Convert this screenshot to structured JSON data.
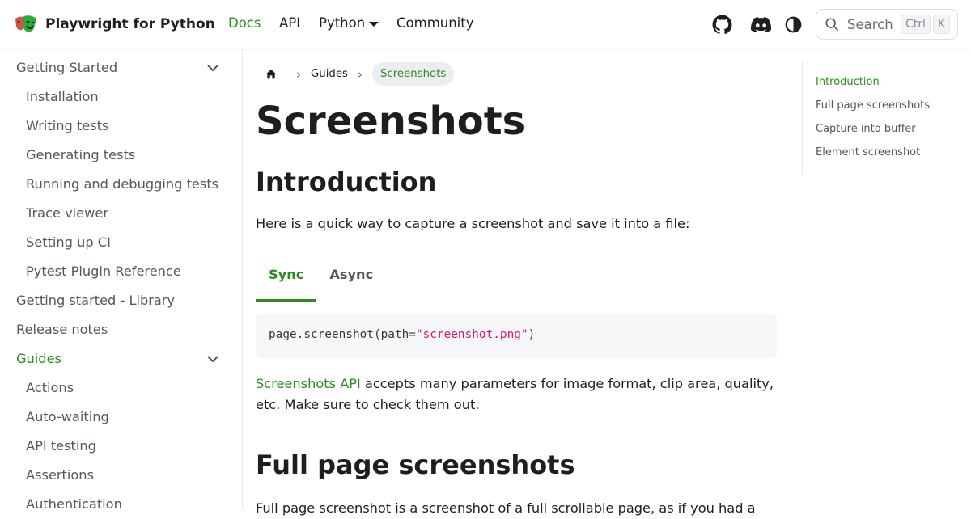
{
  "navbar": {
    "brand_title": "Playwright for Python",
    "links": [
      {
        "label": "Docs",
        "active": true
      },
      {
        "label": "API",
        "active": false
      },
      {
        "label": "Python",
        "active": false
      },
      {
        "label": "Community",
        "active": false
      }
    ],
    "icons": [
      "github-icon",
      "discord-icon",
      "theme-toggle-icon"
    ],
    "search": {
      "label": "Search",
      "shortcut_ctrl": "Ctrl",
      "shortcut_key": "K"
    }
  },
  "sidebar": {
    "items": [
      {
        "label": "Getting Started",
        "level": 0,
        "expandable": true,
        "active": false
      },
      {
        "label": "Installation",
        "level": 1,
        "expandable": false,
        "active": false
      },
      {
        "label": "Writing tests",
        "level": 1,
        "expandable": false,
        "active": false
      },
      {
        "label": "Generating tests",
        "level": 1,
        "expandable": false,
        "active": false
      },
      {
        "label": "Running and debugging tests",
        "level": 1,
        "expandable": false,
        "active": false
      },
      {
        "label": "Trace viewer",
        "level": 1,
        "expandable": false,
        "active": false
      },
      {
        "label": "Setting up CI",
        "level": 1,
        "expandable": false,
        "active": false
      },
      {
        "label": "Pytest Plugin Reference",
        "level": 1,
        "expandable": false,
        "active": false
      },
      {
        "label": "Getting started - Library",
        "level": 0,
        "expandable": false,
        "active": false
      },
      {
        "label": "Release notes",
        "level": 0,
        "expandable": false,
        "active": false
      },
      {
        "label": "Guides",
        "level": 0,
        "expandable": true,
        "active": true
      },
      {
        "label": "Actions",
        "level": 1,
        "expandable": false,
        "active": false
      },
      {
        "label": "Auto-waiting",
        "level": 1,
        "expandable": false,
        "active": false
      },
      {
        "label": "API testing",
        "level": 1,
        "expandable": false,
        "active": false
      },
      {
        "label": "Assertions",
        "level": 1,
        "expandable": false,
        "active": false
      },
      {
        "label": "Authentication",
        "level": 1,
        "expandable": false,
        "active": false
      }
    ]
  },
  "main": {
    "breadcrumbs": {
      "parent": "Guides",
      "current": "Screenshots"
    },
    "title": "Screenshots",
    "intro_heading": "Introduction",
    "intro_text": "Here is a quick way to capture a screenshot and save it into a file:",
    "tabs": [
      {
        "label": "Sync",
        "active": true
      },
      {
        "label": "Async",
        "active": false
      }
    ],
    "code": {
      "prefix": "page.screenshot(path",
      "operator": "=",
      "string": "\"screenshot.png\"",
      "suffix": ")"
    },
    "api_link": "Screenshots API",
    "api_text": " accepts many parameters for image format, clip area, quality, etc. Make sure to check them out.",
    "fullpage_heading": "Full page screenshots",
    "fullpage_text": "Full page screenshot is a screenshot of a full scrollable page, as if you had a"
  },
  "toc": {
    "items": [
      {
        "label": "Introduction",
        "active": true
      },
      {
        "label": "Full page screenshots",
        "active": false
      },
      {
        "label": "Capture into buffer",
        "active": false
      },
      {
        "label": "Element screenshot",
        "active": false
      }
    ]
  },
  "colors": {
    "accent": "#2e8b22",
    "text": "#1c1e21",
    "muted": "#525860",
    "code_bg": "#f6f7f8",
    "string": "#e3116c"
  }
}
